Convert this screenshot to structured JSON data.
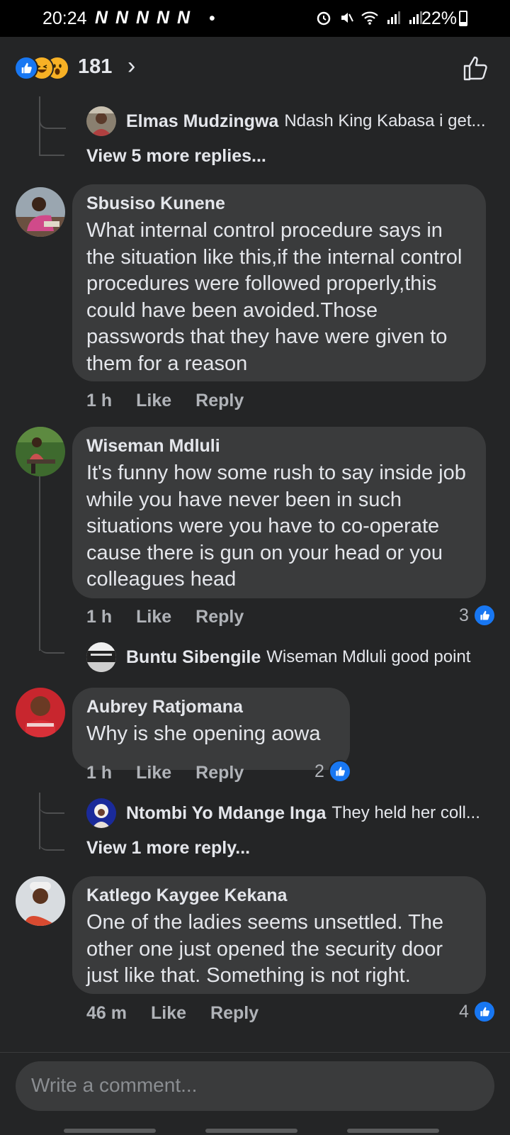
{
  "status_bar": {
    "time": "20:24",
    "notification_icons": "N N N N N",
    "dot": "•",
    "battery_percent": "22%"
  },
  "header": {
    "reaction_count": "181",
    "chevron": "›"
  },
  "comments": [
    {
      "reply_preview": {
        "name": "Elmas Mudzingwa",
        "text": "Ndash King Kabasa i get..."
      },
      "more_replies": "View 5 more replies..."
    },
    {
      "name": "Sbusiso Kunene",
      "text": "What internal control procedure says in the situation like this,if the internal control procedures were followed properly,this could have been avoided.Those passwords that they have were given to them for a reason",
      "time": "1 h",
      "like": "Like",
      "reply": "Reply"
    },
    {
      "name": "Wiseman Mdluli",
      "text": "It's funny how some rush to say inside job while you have never been in such situations were you have to co-operate cause there is gun on your head or you colleagues head",
      "time": "1 h",
      "like": "Like",
      "reply": "Reply",
      "reaction_count": "3",
      "reply_preview": {
        "name": "Buntu Sibengile",
        "text": "Wiseman Mdluli good point"
      }
    },
    {
      "name": "Aubrey Ratjomana",
      "text": "Why is she opening aowa",
      "time": "1 h",
      "like": "Like",
      "reply": "Reply",
      "reaction_count": "2",
      "reply_preview": {
        "name": "Ntombi Yo Mdange Inga",
        "text": "They held her coll..."
      },
      "more_replies": "View 1 more reply..."
    },
    {
      "name": "Katlego Kaygee Kekana",
      "text": "One of the ladies seems unsettled. The other one just opened the security door just like that. Something is not right.",
      "time": "46 m",
      "like": "Like",
      "reply": "Reply",
      "reaction_count": "4"
    }
  ],
  "composer": {
    "placeholder": "Write a comment..."
  },
  "colors": {
    "background": "#242526",
    "bubble": "#3a3b3c",
    "text": "#e4e6eb",
    "secondary_text": "#b0b3b8",
    "like_blue": "#1877f2",
    "haha_yellow": "#f7b125"
  }
}
